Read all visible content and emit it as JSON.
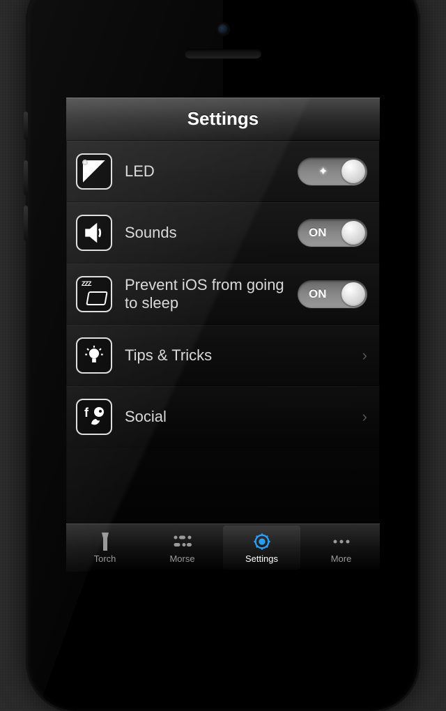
{
  "header": {
    "title": "Settings"
  },
  "rows": {
    "led": {
      "label": "LED",
      "toggle_text": ""
    },
    "sounds": {
      "label": "Sounds",
      "toggle_text": "ON"
    },
    "sleep": {
      "label": "Prevent iOS from going to sleep",
      "toggle_text": "ON"
    },
    "tips": {
      "label": "Tips & Tricks"
    },
    "social": {
      "label": "Social"
    }
  },
  "tabs": {
    "torch": {
      "label": "Torch"
    },
    "morse": {
      "label": "Morse"
    },
    "settings": {
      "label": "Settings"
    },
    "more": {
      "label": "More"
    }
  }
}
